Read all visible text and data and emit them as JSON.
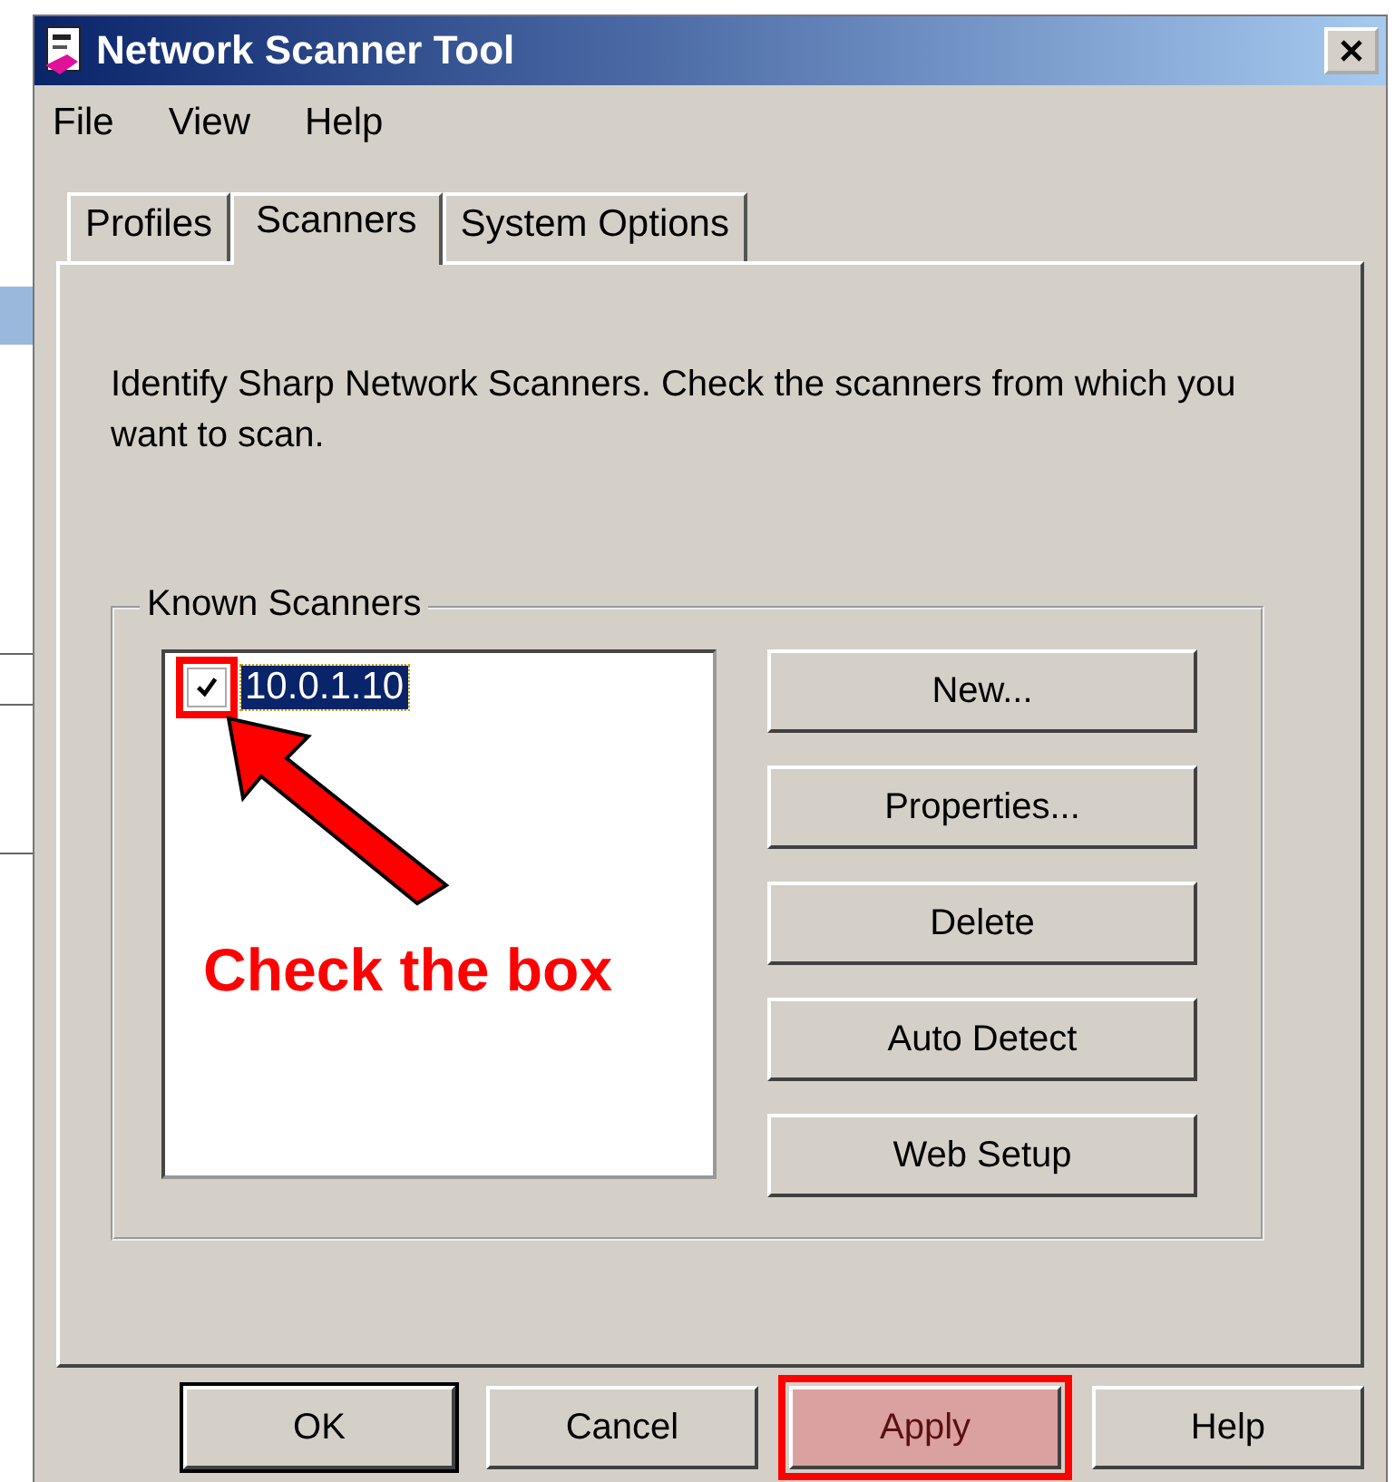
{
  "window": {
    "title": "Network Scanner Tool"
  },
  "menu": [
    "File",
    "View",
    "Help"
  ],
  "tabs": [
    {
      "label": "Profiles",
      "selected": false
    },
    {
      "label": "Scanners",
      "selected": true
    },
    {
      "label": "System Options",
      "selected": false
    }
  ],
  "description": "Identify Sharp Network Scanners. Check the scanners from which you want to scan.",
  "group": {
    "title": "Known Scanners",
    "scanners": [
      {
        "name": "10.0.1.10",
        "checked": true,
        "selected": true,
        "highlighted": true
      }
    ],
    "buttons": [
      {
        "label": "New..."
      },
      {
        "label": "Properties..."
      },
      {
        "label": "Delete"
      },
      {
        "label": "Auto Detect"
      },
      {
        "label": "Web Setup"
      }
    ]
  },
  "annotation": {
    "text": "Check the box"
  },
  "buttons": [
    {
      "label": "OK",
      "default": true,
      "highlighted": false
    },
    {
      "label": "Cancel",
      "default": false,
      "highlighted": false
    },
    {
      "label": "Apply",
      "default": false,
      "highlighted": true
    },
    {
      "label": "Help",
      "default": false,
      "highlighted": false
    }
  ]
}
